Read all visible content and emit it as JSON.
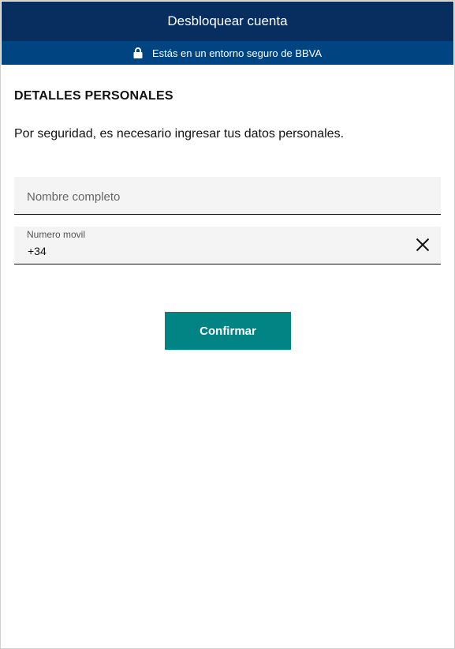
{
  "header": {
    "title": "Desbloquear cuenta",
    "secure_notice": "Estás en un entorno seguro de BBVA",
    "secure_icon": "lock-icon"
  },
  "form": {
    "section_title": "DETALLES PERSONALES",
    "intro_text": "Por seguridad, es necesario ingresar tus datos personales.",
    "name_field": {
      "placeholder": "Nombre completo",
      "value": ""
    },
    "phone_field": {
      "label": "Numero movil",
      "value": "+34",
      "clear_icon": "close-icon"
    },
    "confirm_label": "Confirmar"
  },
  "colors": {
    "topbar": "#072e5f",
    "securebar": "#004481",
    "button": "#028484"
  }
}
